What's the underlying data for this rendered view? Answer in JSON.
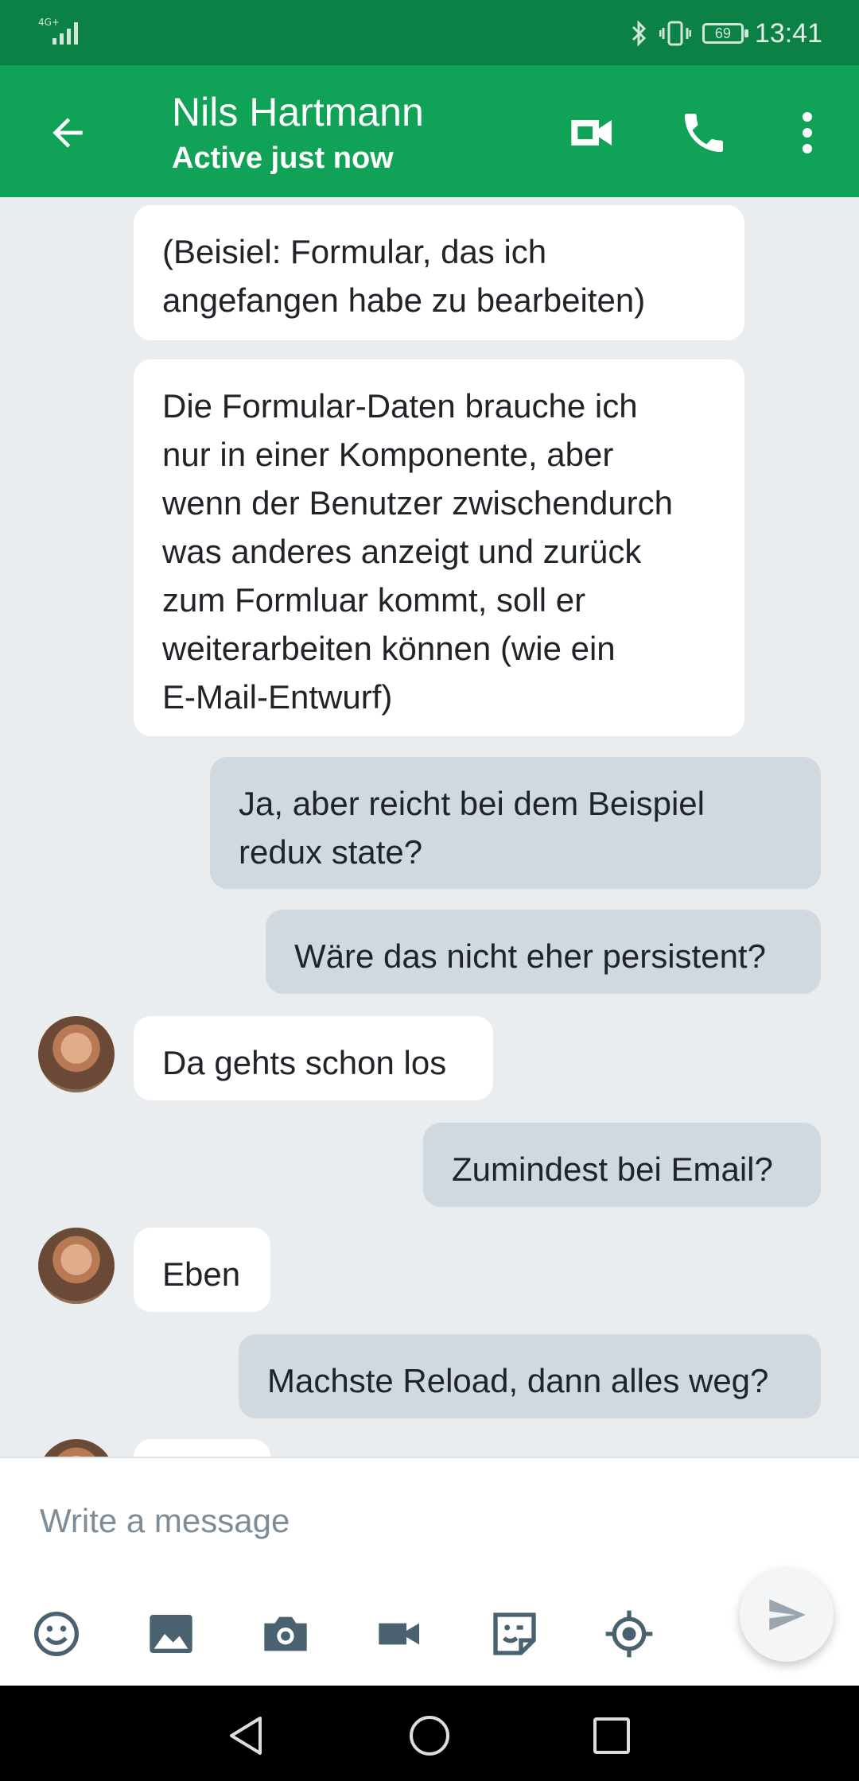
{
  "status_bar": {
    "network": "4G+",
    "battery": "69",
    "time": "13:41"
  },
  "header": {
    "contact_name": "Nils Hartmann",
    "status": "Active just now"
  },
  "messages": [
    {
      "direction": "incoming",
      "text": "(Beisiel: Formular, das ich\nangefangen habe zu bearbeiten)"
    },
    {
      "direction": "incoming",
      "text": "Die Formular-Daten brauche ich\nnur in einer Komponente, aber\nwenn der Benutzer zwischendurch\nwas anderes anzeigt und zurück\nzum Formluar kommt, soll er\nweiterarbeiten können (wie ein\nE-Mail-Entwurf)"
    },
    {
      "direction": "outgoing",
      "text": "Ja, aber reicht bei dem Beispiel\nredux state?"
    },
    {
      "direction": "outgoing",
      "text": "Wäre das nicht eher persistent?"
    },
    {
      "direction": "incoming",
      "text": "Da gehts schon los"
    },
    {
      "direction": "outgoing",
      "text": "Zumindest bei Email?"
    },
    {
      "direction": "incoming",
      "text": "Eben"
    },
    {
      "direction": "outgoing",
      "text": "Machste Reload, dann alles weg?"
    }
  ],
  "composer": {
    "placeholder": "Write a message",
    "tools": [
      "emoji-icon",
      "image-icon",
      "camera-icon",
      "video-icon",
      "sticker-icon",
      "location-icon"
    ]
  },
  "colors": {
    "header": "#10a256",
    "status_bar": "#0b8146",
    "incoming": "#ffffff",
    "outgoing": "#d1d9e0",
    "background": "#e9edf0"
  }
}
